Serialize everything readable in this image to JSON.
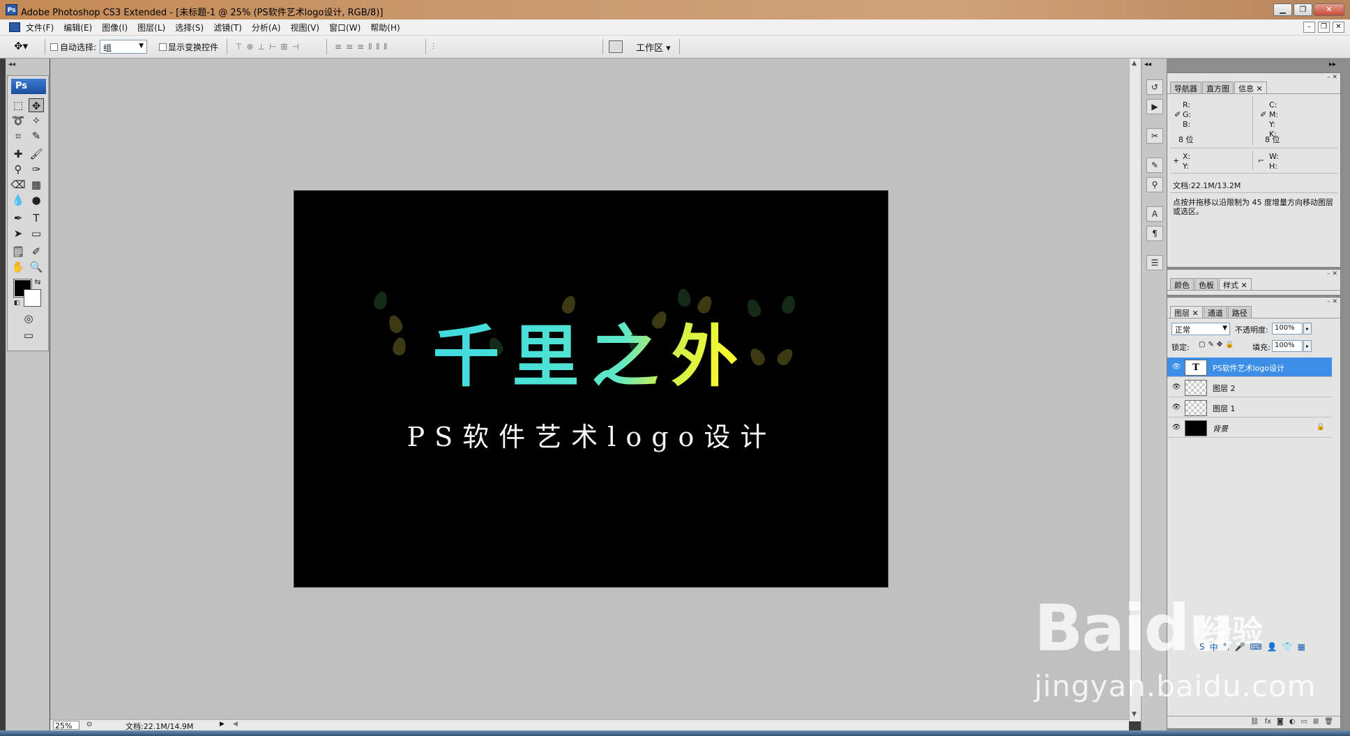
{
  "window": {
    "title": "Adobe Photoshop CS3 Extended - [未标题-1 @ 25% (PS软件艺术logo设计, RGB/8)]",
    "app_icon": "Ps"
  },
  "menu": [
    "文件(F)",
    "编辑(E)",
    "图像(I)",
    "图层(L)",
    "选择(S)",
    "滤镜(T)",
    "分析(A)",
    "视图(V)",
    "窗口(W)",
    "帮助(H)"
  ],
  "options": {
    "auto_select_label": "自动选择:",
    "auto_select_value": "组",
    "show_transform_label": "显示变换控件",
    "workspace_label": "工作区"
  },
  "toolbox": {
    "logo": "Ps",
    "foreground_color": "#000000",
    "background_color": "#ffffff"
  },
  "canvas": {
    "title_text": "千里之外",
    "subtitle_text": "PS软件艺术logo设计",
    "background": "#000000"
  },
  "status": {
    "zoom": "25%",
    "doc_size": "文档:22.1M/14.9M"
  },
  "info_panel": {
    "tabs": [
      "导航器",
      "直方图",
      "信息"
    ],
    "r": "R:",
    "g": "G:",
    "b": "B:",
    "c": "C:",
    "m": "M:",
    "y": "Y:",
    "k": "K:",
    "bits_left": "8 位",
    "bits_right": "8 位",
    "x": "X:",
    "y2": "Y:",
    "w": "W:",
    "h": "H:",
    "doc_size": "文档:22.1M/13.2M",
    "hint": "点按并拖移以沿限制为 45 度增量方向移动图层或选区。"
  },
  "color_panel": {
    "tabs": [
      "颜色",
      "色板",
      "样式"
    ]
  },
  "layers_panel": {
    "tabs": [
      "图层",
      "通道",
      "路径"
    ],
    "blend_mode": "正常",
    "opacity_label": "不透明度:",
    "opacity_value": "100%",
    "lock_label": "锁定:",
    "fill_label": "填充:",
    "fill_value": "100%",
    "layers": [
      {
        "name": "PS软件艺术logo设计",
        "kind": "text",
        "active": true
      },
      {
        "name": "图层 2",
        "kind": "transparent",
        "active": false
      },
      {
        "name": "图层 1",
        "kind": "transparent",
        "active": false
      },
      {
        "name": "背景",
        "kind": "black",
        "active": false,
        "locked": true
      }
    ]
  },
  "watermark": {
    "brand": "Baidu",
    "product": "经验",
    "url": "jingyan.baidu.com"
  }
}
